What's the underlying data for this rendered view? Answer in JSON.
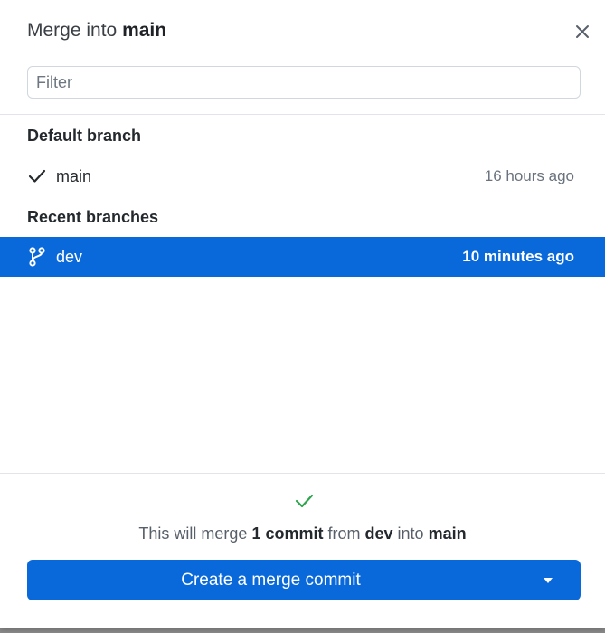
{
  "dialog": {
    "title_prefix": "Merge into ",
    "title_branch": "main",
    "close_label": "×"
  },
  "filter": {
    "placeholder": "Filter",
    "value": ""
  },
  "sections": {
    "default_title": "Default branch",
    "recent_title": "Recent branches"
  },
  "default_branch": {
    "name": "main",
    "time": "16 hours ago",
    "icon": "check-icon"
  },
  "recent_branches": [
    {
      "name": "dev",
      "time": "10 minutes ago",
      "icon": "git-branch-icon",
      "selected": true
    }
  ],
  "summary": {
    "t1": "This will merge ",
    "count": "1 commit",
    "t2": " from ",
    "source": "dev",
    "t3": " into ",
    "target": "main"
  },
  "merge_button": {
    "label": "Create a merge commit"
  },
  "colors": {
    "accent": "#0969da",
    "success": "#2da44e"
  }
}
